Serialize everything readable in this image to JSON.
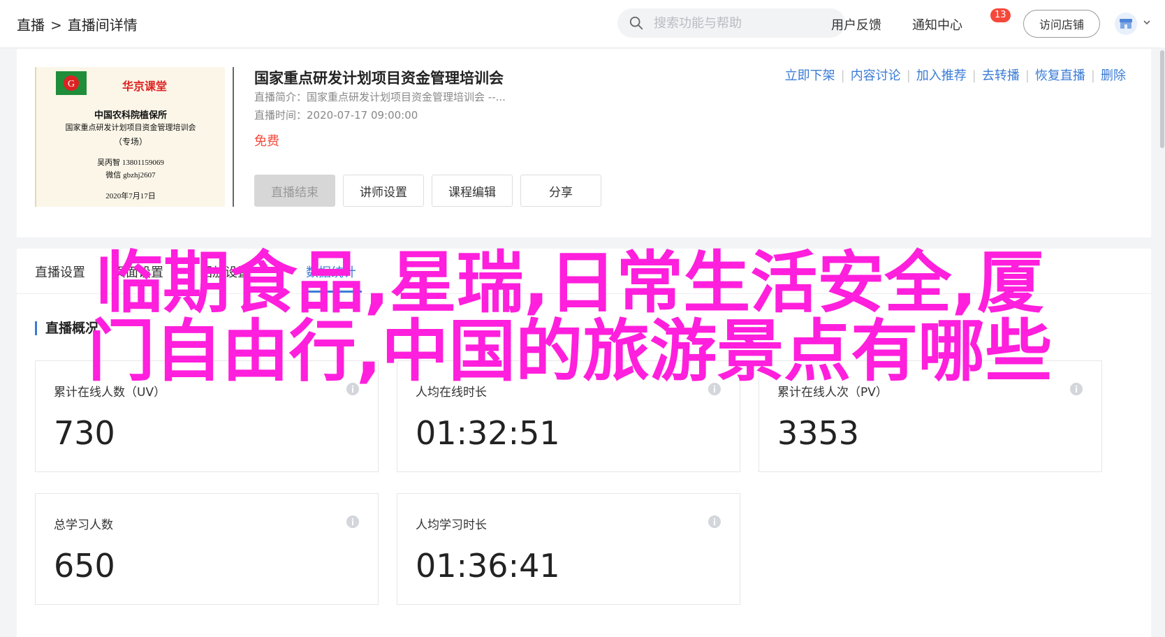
{
  "breadcrumb": {
    "root": "直播",
    "separator": ">",
    "current": "直播间详情"
  },
  "search": {
    "placeholder": "搜索功能与帮助"
  },
  "header": {
    "feedback": "用户反馈",
    "notifications": "通知中心",
    "notification_count": "13",
    "visit_store": "访问店铺"
  },
  "course": {
    "title": "国家重点研发计划项目资金管理培训会",
    "intro_label": "直播简介：",
    "intro_value": "国家重点研发计划项目资金管理培训会 --...",
    "time_label": "直播时间：",
    "time_value": "2020-07-17 09:00:00",
    "price": "免费",
    "cover": {
      "brand": "华京课堂",
      "org": "中国农科院植保所",
      "subject": "国家重点研发计划项目资金管理培训会",
      "tag": "（专场）",
      "contact": "吴丙智 13801159069",
      "wechat": "微信 gbzhj2607",
      "date": "2020年7月17日"
    }
  },
  "buttons": {
    "end_live": "直播结束",
    "lecturer": "讲师设置",
    "edit_course": "课程编辑",
    "share": "分享"
  },
  "actions": [
    "立即下架",
    "内容讨论",
    "加入推荐",
    "去转播",
    "恢复直播",
    "删除"
  ],
  "tabs": [
    "直播设置",
    "页面设置",
    "回放设置",
    "数据统计"
  ],
  "overview_title": "直播概况",
  "stats": [
    {
      "label": "累计在线人数（UV）",
      "value": "730"
    },
    {
      "label": "人均在线时长",
      "value": "01:32:51"
    },
    {
      "label": "累计在线人次（PV）",
      "value": "3353"
    },
    {
      "label": "总学习人数",
      "value": "650"
    },
    {
      "label": "人均学习时长",
      "value": "01:36:41"
    }
  ],
  "overlay": {
    "line1": "临期食品,星瑞,日常生活安全,厦",
    "line2": "门自由行,中国的旅游景点有哪些"
  },
  "colors": {
    "accent": "#3a7bd5",
    "price": "#f5483b",
    "overlay": "#ff1fdc"
  }
}
